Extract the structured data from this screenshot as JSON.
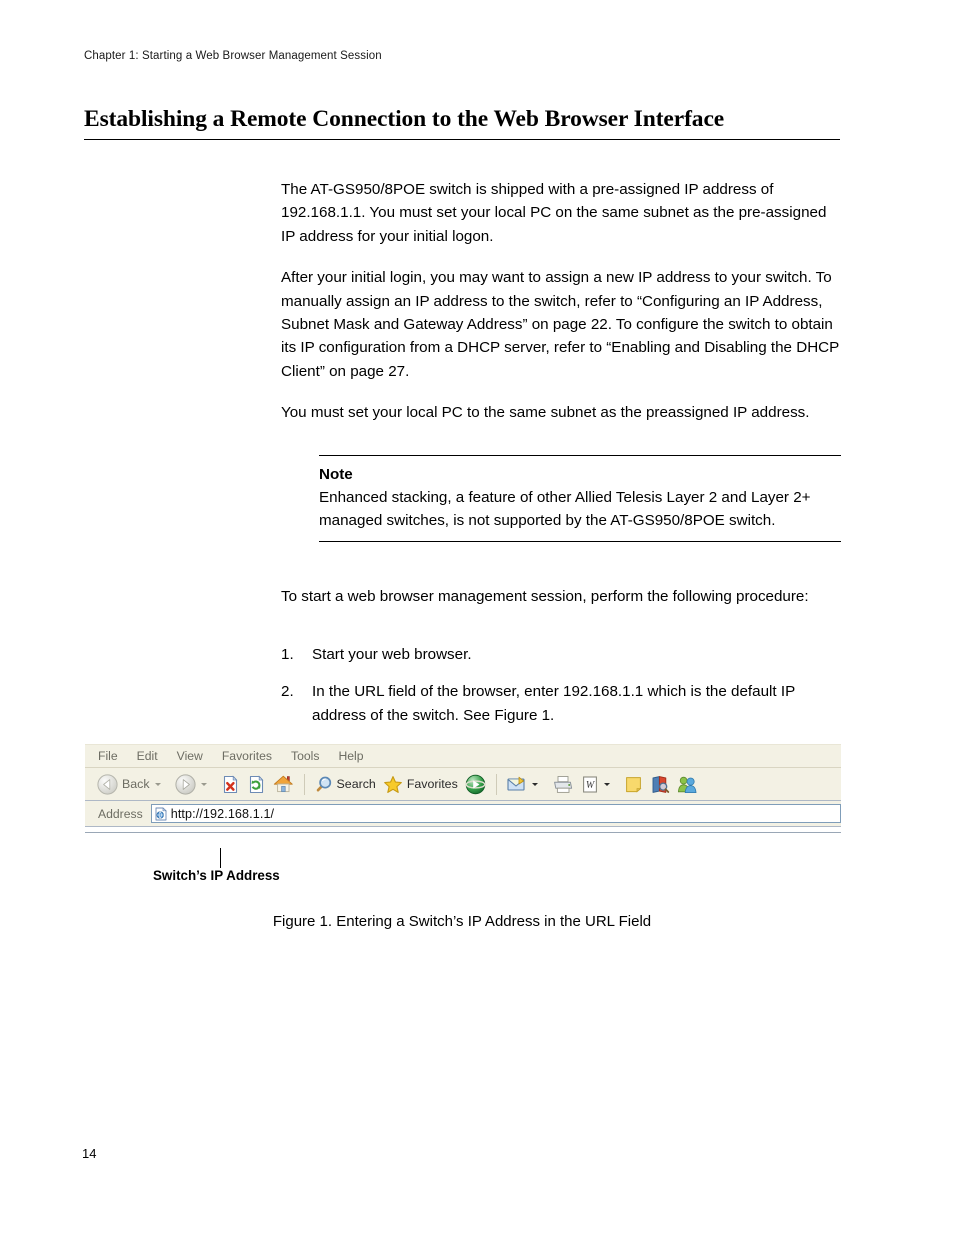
{
  "page": {
    "running_header": "Chapter 1: Starting a Web Browser Management Session",
    "section_heading": "Establishing a Remote Connection to the Web Browser Interface",
    "page_number": "14"
  },
  "body": {
    "paragraph_1": "The AT-GS950/8POE switch is shipped with a pre-assigned IP address of 192.168.1.1. You must set your local PC on the same subnet as the pre-assigned IP address for your initial logon.",
    "paragraph_2": "After your initial login, you may want to assign a new IP address to your switch. To manually assign an IP address to the switch, refer to “Configuring an IP Address, Subnet Mask and Gateway Address” on page 22. To configure the switch to obtain its IP configuration from a DHCP server, refer to “Enabling and Disabling the DHCP Client” on page 27.",
    "paragraph_3": "You must set your local PC to the same subnet as the preassigned IP address."
  },
  "note": {
    "title": "Note",
    "text": "Enhanced stacking, a feature of other Allied Telesis Layer 2 and Layer 2+ managed switches, is not supported by the AT-GS950/8POE switch."
  },
  "procedure": {
    "intro": "To start a web browser management session, perform the following procedure:",
    "steps": [
      {
        "number": "1.",
        "text": "Start your web browser."
      },
      {
        "number": "2.",
        "text": "In the URL field of the browser, enter 192.168.1.1 which is the default IP address of the switch. See Figure 1."
      }
    ]
  },
  "browser_figure": {
    "menu": [
      {
        "label": "File",
        "icon": ""
      },
      {
        "label": "Edit",
        "icon": ""
      },
      {
        "label": "View",
        "icon": ""
      },
      {
        "label": "Favorites",
        "icon": ""
      },
      {
        "label": "Tools",
        "icon": ""
      },
      {
        "label": "Help",
        "icon": ""
      }
    ],
    "toolbar": {
      "back_label": "Back",
      "back_icon": "back-arrow-icon",
      "forward_icon": "forward-arrow-icon",
      "stop_icon": "stop-icon",
      "refresh_icon": "refresh-icon",
      "home_icon": "home-icon",
      "search_label": "Search",
      "search_icon": "magnifier-icon",
      "favorites_label": "Favorites",
      "favorites_icon": "star-icon",
      "media_icon": "media-icon",
      "mail_icon": "mail-icon",
      "print_icon": "printer-icon",
      "edit_icon": "word-editor-icon",
      "notes_icon": "yellow-note-icon",
      "research_icon": "research-icon",
      "messenger_icon": "messenger-icon"
    },
    "address": {
      "label": "Address",
      "icon": "page-globe-icon",
      "url": "http://192.168.1.1/"
    },
    "callout_label": "Switch’s IP Address",
    "caption": "Figure 1. Entering a Switch’s IP Address in the URL Field"
  },
  "colors": {
    "toolbar_background": "#f3f1e4",
    "menu_text": "#6d6d63",
    "address_field_border": "#7f9db9",
    "stop_red": "#d3321e",
    "refresh_green": "#3da03d",
    "home_orange": "#e08a1e",
    "star_yellow": "#f2c31b",
    "note_yellow": "#f7d96b",
    "media_green": "#2c9a4a",
    "text_black": "#000000"
  }
}
